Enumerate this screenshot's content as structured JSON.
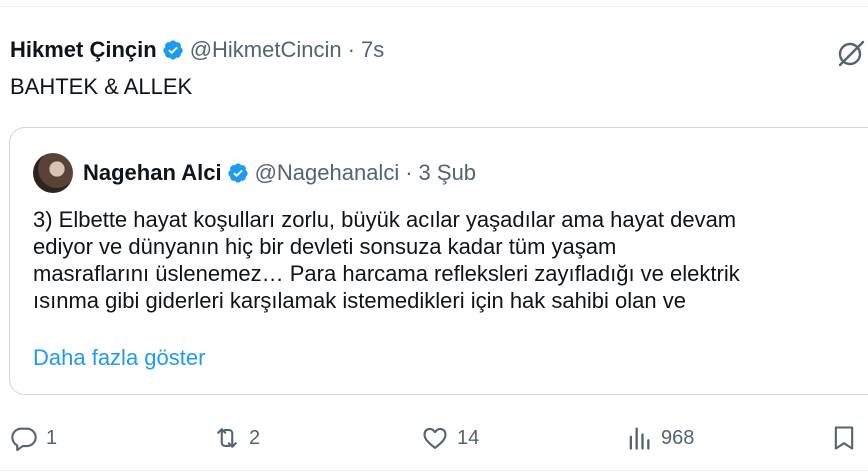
{
  "tweet": {
    "author_name": "Hikmet Çinçin",
    "handle": "@HikmetCincin",
    "separator": "·",
    "time": "7s",
    "text": "BAHTEK & ALLEK"
  },
  "quote": {
    "author_name": "Nagehan Alci",
    "handle": "@Nagehanalci",
    "separator": "·",
    "date": "3 Şub",
    "lines": [
      "3) Elbette hayat koşulları zorlu, büyük acılar yaşadılar ama hayat devam",
      "ediyor ve dünyanın hiç bir devleti sonsuza kadar tüm yaşam",
      "masraflarını üslenemez… Para harcama refleksleri zayıfladığı ve elektrik",
      "ısınma gibi giderleri karşılamak istemedikleri için hak sahibi olan ve"
    ],
    "show_more": "Daha fazla göster"
  },
  "actions": {
    "reply_count": "1",
    "repost_count": "2",
    "like_count": "14",
    "view_count": "968"
  },
  "icons": {
    "verified": "verified-badge-icon",
    "grok": "grok-icon",
    "reply": "reply-icon",
    "repost": "repost-icon",
    "like": "like-icon",
    "views": "views-icon",
    "bookmark": "bookmark-icon"
  },
  "colors": {
    "text": "#0f1419",
    "secondary": "#536471",
    "link": "#1d9bf0",
    "verified": "#1d9bf0",
    "border": "#cfd9de"
  }
}
